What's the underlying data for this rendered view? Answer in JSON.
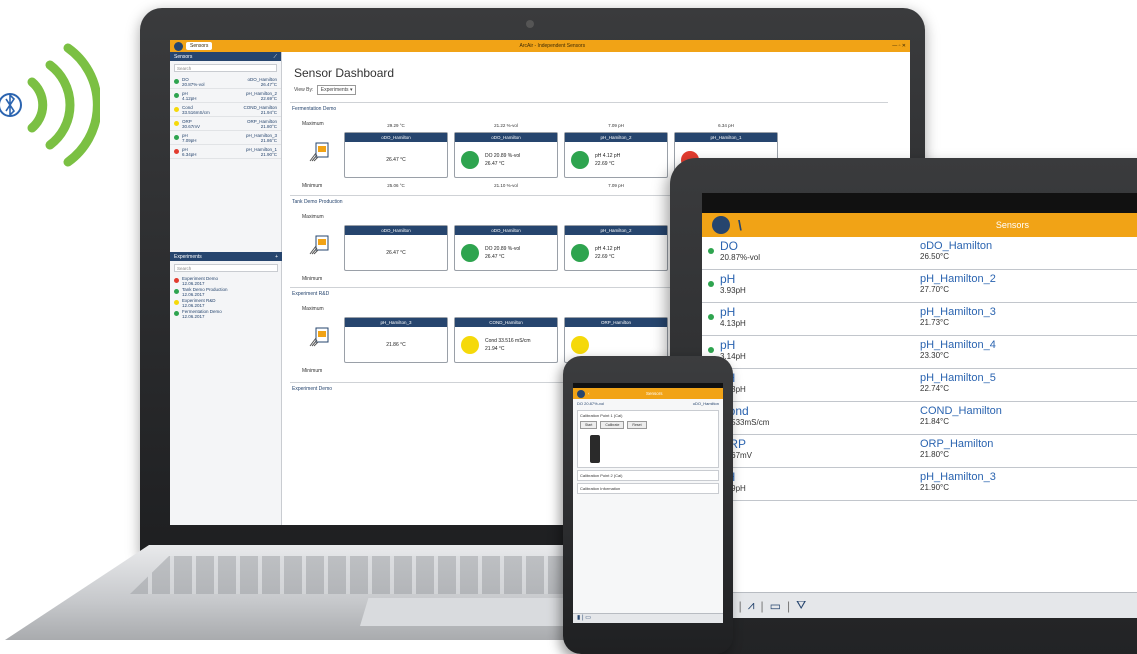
{
  "colors": {
    "accent_orange": "#f1a316",
    "brand_navy": "#26456e",
    "status_green": "#2ea44f",
    "status_red": "#e23b2e",
    "status_yellow": "#f5d90a",
    "link_blue": "#2b64b0"
  },
  "laptop": {
    "window_tab": "Sensors",
    "app_title": "ArcAir - Independent Sensors",
    "sidebar": {
      "sensors_header": "Sensors",
      "search_placeholder": "Search",
      "items": [
        {
          "name": "DO",
          "value": "20.87%-vol",
          "sensor": "oDO_Hamilton",
          "temp": "26.47°C",
          "status": "green"
        },
        {
          "name": "pH",
          "value": "4.12pH",
          "sensor": "pH_Hamilton_2",
          "temp": "22.69°C",
          "status": "green"
        },
        {
          "name": "Cond",
          "value": "33.516mS/cm",
          "sensor": "COND_Hamilton",
          "temp": "21.94°C",
          "status": "yellow"
        },
        {
          "name": "ORP",
          "value": "30.67mV",
          "sensor": "ORP_Hamilton",
          "temp": "21.80°C",
          "status": "yellow"
        },
        {
          "name": "pH",
          "value": "7.09pH",
          "sensor": "pH_Hamilton_3",
          "temp": "21.86°C",
          "status": "green"
        },
        {
          "name": "pH",
          "value": "6.34pH",
          "sensor": "pH_Hamilton_1",
          "temp": "21.90°C",
          "status": "red"
        }
      ],
      "experiments_header": "Experiments",
      "experiments": [
        {
          "name": "Experiment Demo",
          "date": "12.06.2017",
          "status": "red"
        },
        {
          "name": "Tank Demo Production",
          "date": "12.06.2017",
          "status": "green"
        },
        {
          "name": "Experiment R&D",
          "date": "12.06.2017",
          "status": "yellow"
        },
        {
          "name": "Fermentation Demo",
          "date": "12.06.2017",
          "status": "green"
        }
      ]
    },
    "dashboard": {
      "title": "Sensor Dashboard",
      "view_by_label": "View By:",
      "view_by_value": "Experiments",
      "maximum_label": "Maximum",
      "minimum_label": "Minimum",
      "groups": [
        {
          "name": "Fermentation Demo",
          "cards": [
            {
              "sensor": "oDO_Hamilton",
              "type": "single",
              "line1": "26.47 °C",
              "max": "29.29 °C",
              "min": "25.06 °C"
            },
            {
              "sensor": "oDO_Hamilton",
              "type": "circle",
              "color": "green",
              "line1": "DO  20.89 %-vol",
              "line2": "26.47 °C",
              "max": "21.22 %-vol",
              "min": "21.10 %-vol"
            },
            {
              "sensor": "pH_Hamilton_2",
              "type": "circle",
              "color": "green",
              "line1": "pH  4.12 pH",
              "line2": "22.69 °C",
              "max": "7.09 pH",
              "min": "7.09 pH"
            },
            {
              "sensor": "pH_Hamilton_1",
              "type": "circle",
              "color": "red",
              "line1": "",
              "line2": "",
              "max": "6.34 pH",
              "min": ""
            }
          ]
        },
        {
          "name": "Tank Demo Production",
          "cards": [
            {
              "sensor": "oDO_Hamilton",
              "type": "single",
              "line1": "26.47 °C"
            },
            {
              "sensor": "oDO_Hamilton",
              "type": "circle",
              "color": "green",
              "line1": "DO  20.89 %-vol",
              "line2": "26.47 °C"
            },
            {
              "sensor": "pH_Hamilton_2",
              "type": "circle",
              "color": "green",
              "line1": "pH  4.12 pH",
              "line2": "22.69 °C"
            }
          ]
        },
        {
          "name": "Experiment R&D",
          "cards": [
            {
              "sensor": "pH_Hamilton_3",
              "type": "single",
              "line1": "21.86 °C"
            },
            {
              "sensor": "COND_Hamilton",
              "type": "circle",
              "color": "yellow",
              "line1": "Cond  33.516 mS/cm",
              "line2": "21.94 °C"
            },
            {
              "sensor": "ORP_Hamilton",
              "type": "circle",
              "color": "yellow",
              "line1": "",
              "line2": ""
            }
          ]
        },
        {
          "name": "Experiment Demo",
          "cards": []
        }
      ]
    }
  },
  "tablet": {
    "header_title": "Sensors",
    "rows": [
      {
        "name": "DO",
        "value": "20.87%-vol",
        "sensor": "oDO_Hamilton",
        "temp": "26.50°C"
      },
      {
        "name": "pH",
        "value": "3.93pH",
        "sensor": "pH_Hamilton_2",
        "temp": "27.70°C"
      },
      {
        "name": "pH",
        "value": "4.13pH",
        "sensor": "pH_Hamilton_3",
        "temp": "21.73°C"
      },
      {
        "name": "pH",
        "value": "3.14pH",
        "sensor": "pH_Hamilton_4",
        "temp": "23.30°C"
      },
      {
        "name": "pH",
        "value": "4.63pH",
        "sensor": "pH_Hamilton_5",
        "temp": "22.74°C"
      },
      {
        "name": "Cond",
        "value": "33.533mS/cm",
        "sensor": "COND_Hamilton",
        "temp": "21.84°C"
      },
      {
        "name": "ORP",
        "value": "30.67mV",
        "sensor": "ORP_Hamilton",
        "temp": "21.80°C"
      },
      {
        "name": "pH",
        "value": "6.39pH",
        "sensor": "pH_Hamilton_3",
        "temp": "21.90°C"
      }
    ]
  },
  "phone": {
    "header_title": "Sensors",
    "sensor_name": "DO",
    "sensor_value": "20.87%-vol",
    "sensor_id": "oDO_Hamilton",
    "section1": "Calibration Point 1 (Cal)",
    "btn_start": "Start",
    "btn_calibrate": "Calibrate",
    "btn_reset": "Reset",
    "section2": "Calibration Point 2 (Cal)",
    "section3": "Calibration Information"
  }
}
